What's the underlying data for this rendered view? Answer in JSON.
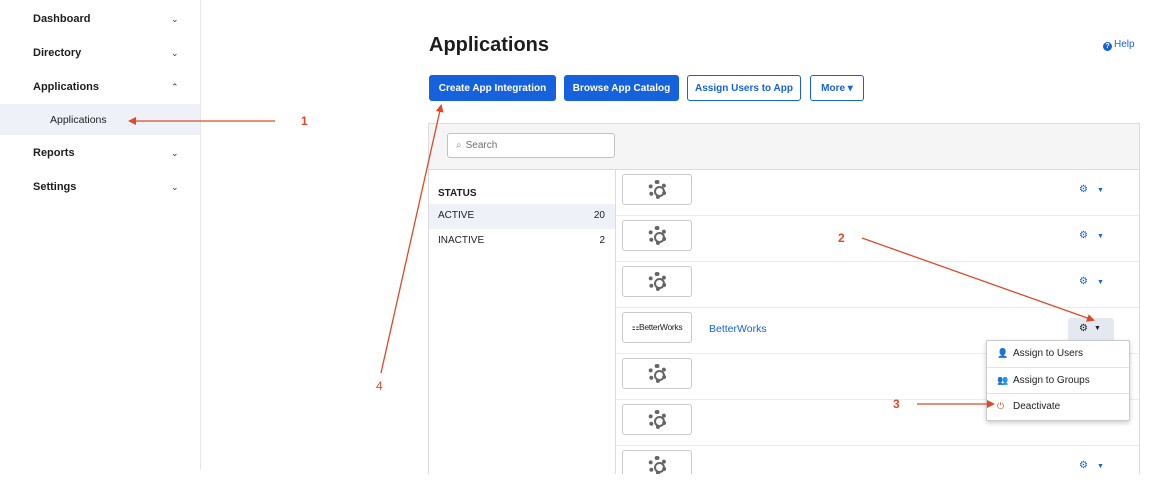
{
  "sidebar": {
    "items": [
      {
        "label": "Dashboard",
        "chevron": "⌄"
      },
      {
        "label": "Directory",
        "chevron": "⌄"
      },
      {
        "label": "Applications",
        "chevron": "⌃"
      },
      {
        "label": "Reports",
        "chevron": "⌄"
      },
      {
        "label": "Settings",
        "chevron": "⌄"
      }
    ],
    "sub_item": "Applications"
  },
  "header": {
    "title": "Applications",
    "help": "Help"
  },
  "toolbar": {
    "create": "Create App Integration",
    "browse": "Browse App Catalog",
    "assign": "Assign Users to App",
    "more": "More ▾"
  },
  "search": {
    "placeholder": "Search"
  },
  "status": {
    "title": "STATUS",
    "rows": [
      {
        "label": "ACTIVE",
        "count": "20"
      },
      {
        "label": "INACTIVE",
        "count": "2"
      }
    ]
  },
  "apps": [
    {
      "logo": "gear-icon",
      "name": ""
    },
    {
      "logo": "gear-icon",
      "name": ""
    },
    {
      "logo": "gear-icon",
      "name": ""
    },
    {
      "logo": "betterworks-logo",
      "logo_text": "⚏BetterWorks",
      "name": "BetterWorks"
    },
    {
      "logo": "gear-icon",
      "name": ""
    },
    {
      "logo": "gear-icon",
      "name": ""
    },
    {
      "logo": "gear-icon",
      "name": ""
    }
  ],
  "row_actions": {
    "gear": "⚙",
    "caret": "▼"
  },
  "dropdown": {
    "items": [
      {
        "icon": "user-icon",
        "glyph": "👤",
        "label": "Assign to Users"
      },
      {
        "icon": "group-icon",
        "glyph": "👥",
        "label": "Assign to Groups"
      },
      {
        "icon": "power-icon",
        "glyph": "⏻",
        "label": "Deactivate"
      }
    ]
  },
  "annotations": {
    "a1": "1",
    "a2": "2",
    "a3": "3",
    "a4": "4"
  },
  "colors": {
    "accent": "#1662dd",
    "annotation": "#dd4a2a"
  }
}
